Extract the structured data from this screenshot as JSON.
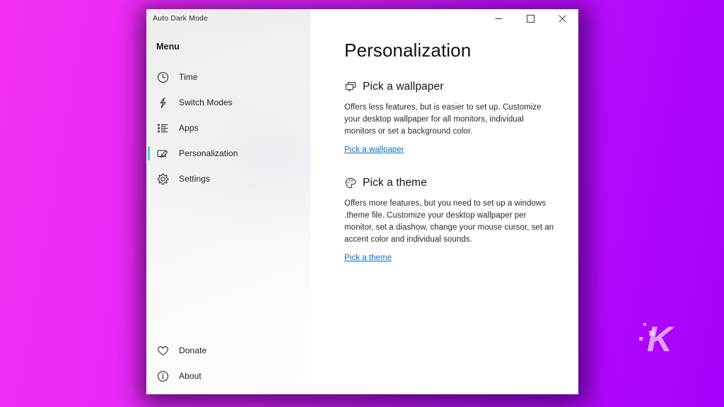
{
  "window": {
    "title": "Auto Dark Mode",
    "controls": [
      {
        "name": "minimize",
        "label": "Minimize"
      },
      {
        "name": "maximize",
        "label": "Maximize"
      },
      {
        "name": "close",
        "label": "Close"
      }
    ]
  },
  "sidebar": {
    "heading": "Menu",
    "accent_color": "#58c5d8",
    "items": [
      {
        "label": "Time",
        "icon": "clock-icon",
        "selected": false
      },
      {
        "label": "Switch Modes",
        "icon": "lightning-icon",
        "selected": false
      },
      {
        "label": "Apps",
        "icon": "list-icon",
        "selected": false
      },
      {
        "label": "Personalization",
        "icon": "brush-board-icon",
        "selected": true
      },
      {
        "label": "Settings",
        "icon": "gear-icon",
        "selected": false
      }
    ],
    "bottom_items": [
      {
        "label": "Donate",
        "icon": "heart-icon"
      },
      {
        "label": "About",
        "icon": "info-circle-icon"
      }
    ]
  },
  "content": {
    "title": "Personalization",
    "link_color": "#0b6ec9",
    "sections": [
      {
        "icon": "monitors-icon",
        "title": "Pick a wallpaper",
        "description": "Offers less features, but is easier to set up. Customize your desktop wallpaper for all monitors, individual monitors or set a background color.",
        "link": "Pick a wallpaper"
      },
      {
        "icon": "palette-icon",
        "title": "Pick a theme",
        "description": "Offers more features, but you need to set up a windows .theme file. Customize your desktop wallpaper per monitor, set a diashow, change your mouse cursor, set an accent color and individual sounds.",
        "link": "Pick a theme"
      }
    ]
  },
  "desktop": {
    "watermark_letter": "K",
    "background_from": "#f22ef2",
    "background_to": "#a400fb"
  }
}
